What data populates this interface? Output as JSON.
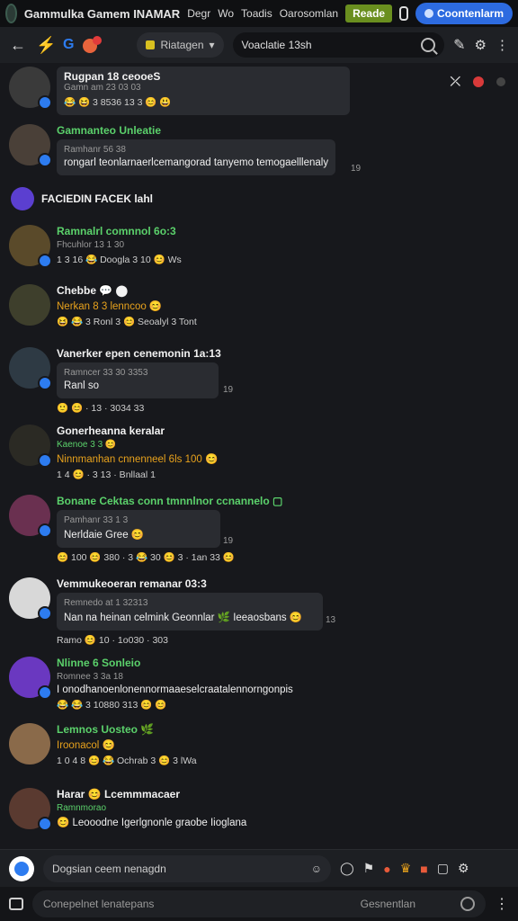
{
  "topbar": {
    "title": "Gammulka Gamem INAMAR",
    "links": [
      "Degr",
      "Wo",
      "Toadis",
      "Oarosomlan"
    ],
    "green_button": "Reade",
    "blue_button": "Coontenlarm"
  },
  "navbar": {
    "g_letter": "G",
    "channel": "Riatagen",
    "search_text": "Voaclatie 13sh"
  },
  "system_message": "FACIEDIN FACEK lahl",
  "messages": [
    {
      "name": "Rugpan 18 ceooeS",
      "sub": "Gamn am 23 03 03",
      "text": "",
      "meta": "😂 😆 3 8536 13 3 😊 😃",
      "timestamp": ""
    },
    {
      "name": "Gamnanteo Unleatie",
      "sub": "Ramhanr 56 38",
      "text": "rongarl teonlarnaerlcemangorad tanyemo temogaelllenaly",
      "meta": "",
      "timestamp": "19"
    },
    {
      "name": "Ramnalrl comnnol 6o:3",
      "sub": "Fhcuhlor 13 1 30",
      "text": "",
      "meta": "1 3 16 😂 Doogla 3 10 😊 Ws",
      "timestamp": ""
    },
    {
      "name": "Chebbe 💬 ⬤",
      "sub": "Nerkan 8 3 lenncoo 😊",
      "text": "",
      "meta": "😆 😂 3 Ronl 3 😊 Seoalyl 3 Tont",
      "timestamp": ""
    },
    {
      "name": "Vanerker epen cenemonin 1a:13",
      "sub": "Ramncer 33 30 3353",
      "text": "Ranl so",
      "meta": "🙂 😊 · 13 · 3034 33",
      "timestamp": "19"
    },
    {
      "name": "Gonerheanna keralar",
      "sub": "Kaenoe 3 3 😊",
      "text": "Ninnmanhan cnnenneel 6ls 100 😊",
      "meta": "1 4 😊 · 3 13 · Bnllaal 1",
      "timestamp": ""
    },
    {
      "name": "Bonane Cektas conn tmnnlnor ccnannelo ▢",
      "sub": "Pamhanr 33 1 3",
      "text": "Nerldaie Gree 😊",
      "meta": "😊 100 😊 380 · 3 😂 30 😊 3 · 1an 33 😊",
      "timestamp": "19"
    },
    {
      "name": "Vemmukeoeran remanar 03:3",
      "sub": "Remnedo at 1 32313",
      "text": "Nan na heinan celmink Geonnlar 🌿 Ieeaosbans 😊",
      "meta": "Ramo 😊 10 · 1o030 · 303",
      "timestamp": "13"
    },
    {
      "name": "Nlinne 6 Sonleio",
      "sub": "Romnee 3 3a 18",
      "text": "I onodhanoenlonennormaaeselcraatalennorngonpis",
      "meta": "😂 😂 3 10880 313 😊 😊",
      "timestamp": ""
    },
    {
      "name": "Lemnos Uosteo 🌿",
      "sub": "Iroonacol 😊",
      "text": "",
      "meta": "1 0 4 8 😊 😂 Ochrab 3 😊 3 lWa",
      "timestamp": ""
    },
    {
      "name": "Harar 😊 Lcemmmacaer",
      "sub": "Ramnmorao",
      "text": "😊 Leooodne Igerlgnonle graobe Iioglana",
      "meta": "",
      "timestamp": ""
    }
  ],
  "composer": {
    "placeholder1": "Dogsian ceem nenagdn",
    "placeholder2": "Conepelnet lenatepans",
    "label2": "Gesnentlan"
  },
  "colors": {
    "background": "#17181c",
    "green_name": "#5bd16b",
    "accent_blue": "#2d6be0",
    "accent_green": "#6a8f1f"
  }
}
